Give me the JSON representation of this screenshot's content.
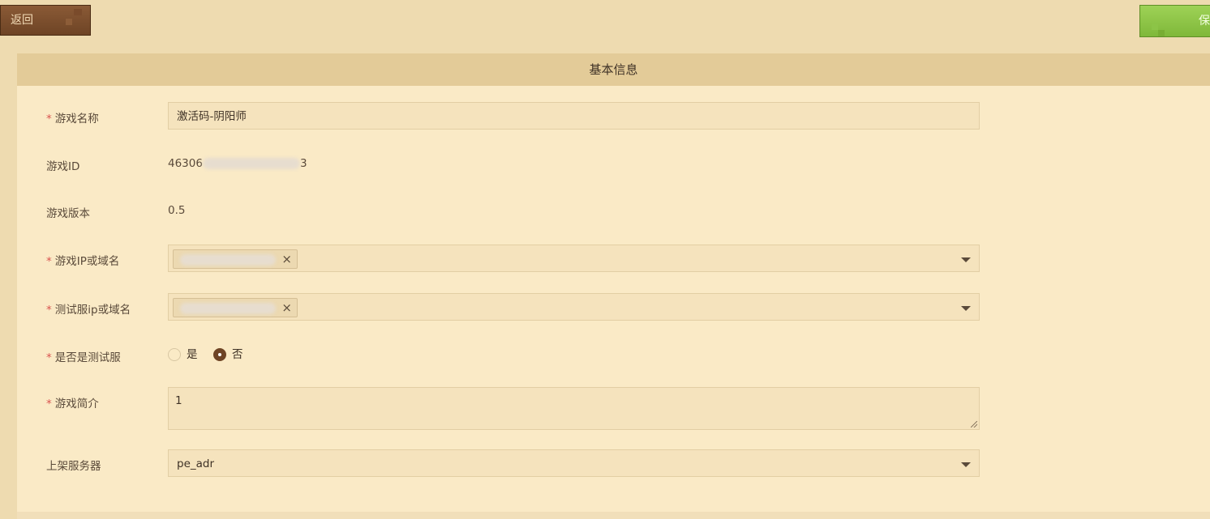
{
  "toolbar": {
    "back_label": "返回",
    "save_label": "保"
  },
  "panel": {
    "title": "基本信息"
  },
  "form": {
    "game_name": {
      "label": "游戏名称",
      "value": "激活码-阴阳师"
    },
    "game_id": {
      "label": "游戏ID",
      "value": "46306",
      "value_tail": "3"
    },
    "game_version": {
      "label": "游戏版本",
      "value": "0.5"
    },
    "game_ip": {
      "label": "游戏IP或域名"
    },
    "test_ip": {
      "label": "测试服ip或域名"
    },
    "is_test": {
      "label": "是否是测试服",
      "options": [
        "是",
        "否"
      ],
      "selected": "否"
    },
    "intro": {
      "label": "游戏简介",
      "value": "1"
    },
    "server": {
      "label": "上架服务器",
      "value": "pe_adr"
    }
  },
  "required_mark": "*",
  "tag_remove_symbol": "×"
}
